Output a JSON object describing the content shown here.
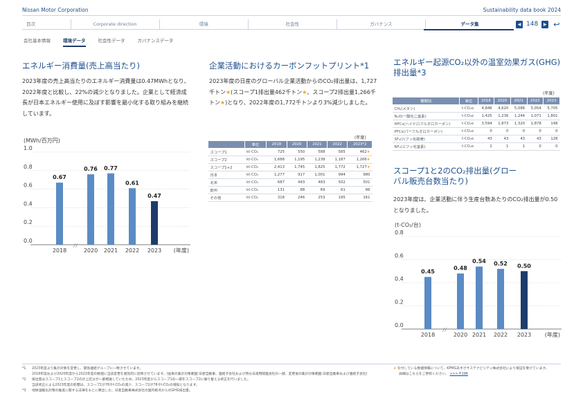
{
  "header": {
    "brand": "Nissan Motor Corporation",
    "databook": "Sustainability data book 2024",
    "nav": [
      "目次",
      "Corporate direction",
      "環境",
      "社会性",
      "ガバナンス",
      "データ集"
    ],
    "page": "148"
  },
  "subnav": [
    "会社基本情報",
    "環境データ",
    "社会性データ",
    "ガバナンスデータ"
  ],
  "energy": {
    "title": "エネルギー消費量(売上高当たり)",
    "text": "2023年度の売上高当たりのエネルギー消費量は0.47MWhとなり、2022年度と比較し、22%の減少となりました。企業として経済成長が日本エネルギー使用に及ぼす影響を最小化する取り組みを継続しています。",
    "unit": "(MWh/百万円)"
  },
  "carbon": {
    "title": "企業活動におけるカーボンフットプリント*1",
    "text_a": "2023年度の日産のグローバル企業活動からのCO₂排出量は、1,727千トン",
    "text_b": "(スコープ1排出量462千トン",
    "text_c": "、スコープ2排出量1,266千トン",
    "text_d": ")となり、2022年度の1,772千トンより3%減少しました。",
    "nendo": "(年度)",
    "headers": [
      "",
      "単位",
      "2018",
      "2020",
      "2021",
      "2022",
      "2023*2"
    ],
    "rows": [
      [
        "スコープ1",
        "kt-CO₂",
        "725",
        "550",
        "588",
        "585",
        "462★"
      ],
      [
        "スコープ2",
        "kt-CO₂",
        "1,688",
        "1,195",
        "1,238",
        "1,187",
        "1,266★"
      ],
      [
        "スコープ1+2",
        "kt-CO₂",
        "2,413",
        "1,745",
        "1,825",
        "1,772",
        "1,727★"
      ],
      [
        "日本",
        "kt-CO₂",
        "1,277",
        "917",
        "1,001",
        "994",
        "980"
      ],
      [
        "北米",
        "kt-CO₂",
        "687",
        "493",
        "483",
        "502",
        "501"
      ],
      [
        "欧州",
        "kt-CO₂",
        "131",
        "88",
        "69",
        "61",
        "86"
      ],
      [
        "その他",
        "kt-CO₂",
        "318",
        "246",
        "253",
        "195",
        "161"
      ]
    ]
  },
  "ghg": {
    "title": "エネルギー起源CO₂以外の温室効果ガス(GHG)排出量*3",
    "nendo": "(年度)",
    "headers": [
      "種類別",
      "単位",
      "2018",
      "2020",
      "2021",
      "2022",
      "2023"
    ],
    "rows": [
      [
        "CH₄(メタン)",
        "t-CO₂e",
        "4,846",
        "4,620",
        "5,088",
        "5,054",
        "5,705"
      ],
      [
        "N₂O(一酸化二窒素)",
        "t-CO₂e",
        "1,425",
        "1,236",
        "1,244",
        "1,071",
        "1,801"
      ],
      [
        "HFCs(ハイドロフルオロカーボン)",
        "t-CO₂e",
        "3,594",
        "1,873",
        "1,320",
        "1,878",
        "148"
      ],
      [
        "PFCs(パーフルオロカーボン)",
        "t-CO₂e",
        "0",
        "0",
        "0",
        "0",
        "0"
      ],
      [
        "SF₆(六フッ化硫黄)",
        "t-CO₂e",
        "43",
        "43",
        "43",
        "43",
        "128"
      ],
      [
        "NF₃(三フッ化窒素)",
        "t-CO₂e",
        "2",
        "1",
        "1",
        "0",
        "0"
      ]
    ]
  },
  "scope": {
    "title": "スコープ1と2のCO₂排出量(グローバル販売台数当たり)",
    "text": "2023年度は、企業活動に伴う生産台数あたりのCO₂排出量が0.50となりました。",
    "unit": "(t-CO₂/台)"
  },
  "chart_data": [
    {
      "type": "bar",
      "categories": [
        "2018",
        "2020",
        "2021",
        "2022",
        "2023"
      ],
      "values": [
        0.67,
        0.76,
        0.77,
        0.61,
        0.47
      ],
      "labels": [
        "0.67",
        "0.76",
        "0.77",
        "0.61",
        "0.47"
      ],
      "ylim": [
        0,
        1.0
      ],
      "yticks": [
        "0.0",
        "0.2",
        "0.4",
        "0.6",
        "0.8",
        "1.0"
      ],
      "ylabel": "(MWh/百万円)",
      "xlabel": "(年度)",
      "colors": [
        "#5b8bc4",
        "#5b8bc4",
        "#5b8bc4",
        "#5b8bc4",
        "#1d3c6b"
      ]
    },
    {
      "type": "bar",
      "categories": [
        "2018",
        "2020",
        "2021",
        "2022",
        "2023"
      ],
      "values": [
        0.45,
        0.48,
        0.54,
        0.52,
        0.5
      ],
      "labels": [
        "0.45",
        "0.48",
        "0.54",
        "0.52",
        "0.50"
      ],
      "ylim": [
        0,
        0.8
      ],
      "yticks": [
        "0.0",
        "0.2",
        "0.4",
        "0.6",
        "0.8"
      ],
      "ylabel": "(t-CO₂/台)",
      "xlabel": "(年度)",
      "colors": [
        "#5b8bc4",
        "#5b8bc4",
        "#5b8bc4",
        "#5b8bc4",
        "#1d3c6b"
      ]
    }
  ],
  "footnotes": {
    "n1": "2023年度より集計対象を変更し、関係連結グループに一致させています。",
    "n1b": "2018年度および2020年度から2022年度の数値に当該変更を遡及的に反映させています。(従来の集計対象範囲:日産自動車、連結子会社および持分法適用関連会社の一部、変更後の集計対象範囲:日産自動車および連結子会社)",
    "n2": "排出量はスコープ1とスコープ2の計上区分が一部相違していたため、2023年度からスコープ1の一部をスコープ2に振り替える修正を行いました。",
    "n2b": "当該修正による2023年度の影響は、スコープ1が78千t-CO₂の減少、スコープ2が78千t-CO₂の増加となります。",
    "n3": "地球温暖化対策の推進に関する法律をもとに算出した、日産自動車株式会社の国内拠点からのGHG排出量。",
    "marks": [
      "*1",
      "*2",
      "*3"
    ],
    "star_note": "を付している数値情報について、KPMGあずさサステナビリティ株式会社により保証を受けています。",
    "star_note2": "詳細はこちらをご参照ください。",
    "link": ">>> P.196"
  }
}
